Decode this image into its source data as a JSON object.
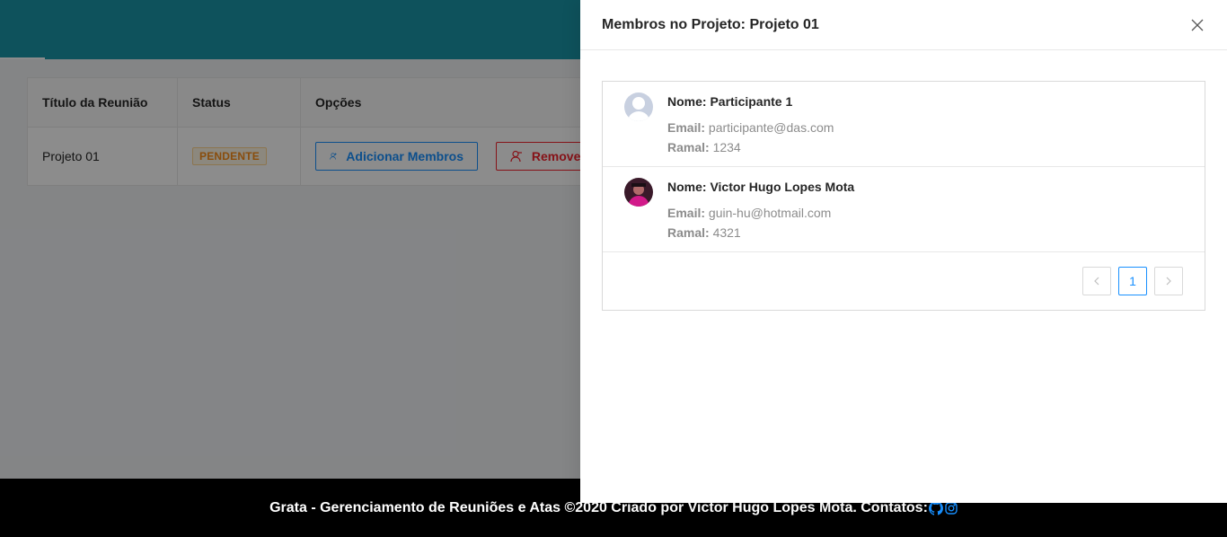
{
  "table": {
    "headers": [
      "Título da Reunião",
      "Status",
      "Opções"
    ],
    "row": {
      "title": "Projeto 01",
      "status": "PENDENTE",
      "add_label": "Adicionar Membros",
      "remove_label": "Remover"
    }
  },
  "drawer": {
    "title": "Membros no Projeto: Projeto 01",
    "members": [
      {
        "name": "Nome: Participante 1",
        "email_label": "Email:",
        "email": "participante@das.com",
        "ramal_label": "Ramal:",
        "ramal": "1234"
      },
      {
        "name": "Nome: Victor Hugo Lopes Mota",
        "email_label": "Email:",
        "email": "guin-hu@hotmail.com",
        "ramal_label": "Ramal:",
        "ramal": "4321"
      }
    ],
    "pagination": {
      "current": "1"
    }
  },
  "footer": {
    "text": "Grata - Gerenciamento de Reuniões e Atas ©2020 Criado por Victor Hugo Lopes Mota. Contatos:",
    "icons": [
      "github-icon",
      "instagram-icon"
    ]
  },
  "colors": {
    "header": "#1a96a8",
    "primary": "#1890ff",
    "danger": "#f5222d",
    "warning": "#fa8c16",
    "footer_bg": "#000000"
  }
}
